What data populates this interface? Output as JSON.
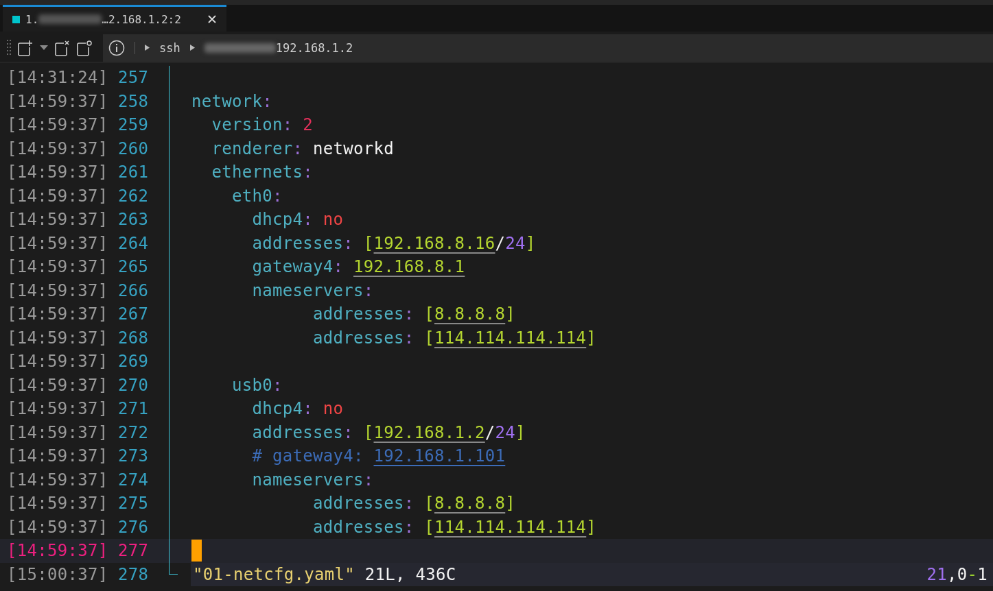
{
  "tab": {
    "title_start": "1.",
    "title_end": "…2.168.1.2:2",
    "selected": true
  },
  "breadcrumb": {
    "command": "ssh",
    "host_end": "192.168.1.2"
  },
  "lines": [
    {
      "time": "[14:31:24]",
      "number": "257",
      "current": false
    },
    {
      "time": "[14:59:37]",
      "number": "258",
      "current": false,
      "segments": [
        {
          "kind": "key",
          "text": "network"
        },
        {
          "kind": "punct",
          "text": ":"
        }
      ]
    },
    {
      "time": "[14:59:37]",
      "number": "259",
      "current": false,
      "segments": [
        {
          "kind": "key",
          "text": "  version"
        },
        {
          "kind": "punct",
          "text": ": "
        },
        {
          "kind": "number",
          "text": "2"
        }
      ]
    },
    {
      "time": "[14:59:37]",
      "number": "260",
      "current": false,
      "segments": [
        {
          "kind": "key",
          "text": "  renderer"
        },
        {
          "kind": "punct",
          "text": ": "
        },
        {
          "kind": "plain",
          "text": "networkd"
        }
      ]
    },
    {
      "time": "[14:59:37]",
      "number": "261",
      "current": false,
      "segments": [
        {
          "kind": "key",
          "text": "  ethernets"
        },
        {
          "kind": "punct",
          "text": ":"
        }
      ]
    },
    {
      "time": "[14:59:37]",
      "number": "262",
      "current": false,
      "segments": [
        {
          "kind": "key",
          "text": "    eth0"
        },
        {
          "kind": "punct",
          "text": ":"
        }
      ]
    },
    {
      "time": "[14:59:37]",
      "number": "263",
      "current": false,
      "segments": [
        {
          "kind": "key",
          "text": "      dhcp4"
        },
        {
          "kind": "punct",
          "text": ": "
        },
        {
          "kind": "bool",
          "text": "no"
        }
      ]
    },
    {
      "time": "[14:59:37]",
      "number": "264",
      "current": false,
      "segments": [
        {
          "kind": "key",
          "text": "      addresses"
        },
        {
          "kind": "punct",
          "text": ": "
        },
        {
          "kind": "bracket",
          "text": "["
        },
        {
          "kind": "ip",
          "text": "192.168.8.16"
        },
        {
          "kind": "plain",
          "text": "/"
        },
        {
          "kind": "mask",
          "text": "24"
        },
        {
          "kind": "bracket",
          "text": "]"
        }
      ]
    },
    {
      "time": "[14:59:37]",
      "number": "265",
      "current": false,
      "segments": [
        {
          "kind": "key",
          "text": "      gateway4"
        },
        {
          "kind": "punct",
          "text": ": "
        },
        {
          "kind": "ip",
          "text": "192.168.8.1"
        }
      ]
    },
    {
      "time": "[14:59:37]",
      "number": "266",
      "current": false,
      "segments": [
        {
          "kind": "key",
          "text": "      nameservers"
        },
        {
          "kind": "punct",
          "text": ":"
        }
      ]
    },
    {
      "time": "[14:59:37]",
      "number": "267",
      "current": false,
      "segments": [
        {
          "kind": "key",
          "text": "            addresses"
        },
        {
          "kind": "punct",
          "text": ": "
        },
        {
          "kind": "bracket",
          "text": "["
        },
        {
          "kind": "ip",
          "text": "8.8.8.8"
        },
        {
          "kind": "bracket",
          "text": "]"
        }
      ]
    },
    {
      "time": "[14:59:37]",
      "number": "268",
      "current": false,
      "segments": [
        {
          "kind": "key",
          "text": "            addresses"
        },
        {
          "kind": "punct",
          "text": ": "
        },
        {
          "kind": "bracket",
          "text": "["
        },
        {
          "kind": "ip",
          "text": "114.114.114.114"
        },
        {
          "kind": "bracket",
          "text": "]"
        }
      ]
    },
    {
      "time": "[14:59:37]",
      "number": "269",
      "current": false
    },
    {
      "time": "[14:59:37]",
      "number": "270",
      "current": false,
      "segments": [
        {
          "kind": "key",
          "text": "    usb0"
        },
        {
          "kind": "punct",
          "text": ":"
        }
      ]
    },
    {
      "time": "[14:59:37]",
      "number": "271",
      "current": false,
      "segments": [
        {
          "kind": "key",
          "text": "      dhcp4"
        },
        {
          "kind": "punct",
          "text": ": "
        },
        {
          "kind": "bool",
          "text": "no"
        }
      ]
    },
    {
      "time": "[14:59:37]",
      "number": "272",
      "current": false,
      "segments": [
        {
          "kind": "key",
          "text": "      addresses"
        },
        {
          "kind": "punct",
          "text": ": "
        },
        {
          "kind": "bracket",
          "text": "["
        },
        {
          "kind": "ip",
          "text": "192.168.1.2"
        },
        {
          "kind": "plain",
          "text": "/"
        },
        {
          "kind": "mask",
          "text": "24"
        },
        {
          "kind": "bracket",
          "text": "]"
        }
      ]
    },
    {
      "time": "[14:59:37]",
      "number": "273",
      "current": false,
      "segments": [
        {
          "kind": "comment",
          "text": "      # gateway4: "
        },
        {
          "kind": "comment-ip",
          "text": "192.168.1.101"
        }
      ]
    },
    {
      "time": "[14:59:37]",
      "number": "274",
      "current": false,
      "segments": [
        {
          "kind": "key",
          "text": "      nameservers"
        },
        {
          "kind": "punct",
          "text": ":"
        }
      ]
    },
    {
      "time": "[14:59:37]",
      "number": "275",
      "current": false,
      "segments": [
        {
          "kind": "key",
          "text": "            addresses"
        },
        {
          "kind": "punct",
          "text": ": "
        },
        {
          "kind": "bracket",
          "text": "["
        },
        {
          "kind": "ip",
          "text": "8.8.8.8"
        },
        {
          "kind": "bracket",
          "text": "]"
        }
      ]
    },
    {
      "time": "[14:59:37]",
      "number": "276",
      "current": false,
      "segments": [
        {
          "kind": "key",
          "text": "            addresses"
        },
        {
          "kind": "punct",
          "text": ": "
        },
        {
          "kind": "bracket",
          "text": "["
        },
        {
          "kind": "ip",
          "text": "114.114.114.114"
        },
        {
          "kind": "bracket",
          "text": "]"
        }
      ]
    },
    {
      "time": "[14:59:37]",
      "number": "277",
      "current": true
    },
    {
      "time": "[15:00:37]",
      "number": "278",
      "current": false
    }
  ],
  "status_line": {
    "message": [
      {
        "kind": "filename",
        "text": "\"01-netcfg.yaml\""
      },
      {
        "kind": "plain",
        "text": " 21L, 436C"
      }
    ],
    "position": [
      {
        "kind": "mask",
        "text": "21"
      },
      {
        "kind": "plain",
        "text": ",0"
      },
      {
        "kind": "dash",
        "text": "-"
      },
      {
        "kind": "plain",
        "text": "1"
      }
    ]
  }
}
